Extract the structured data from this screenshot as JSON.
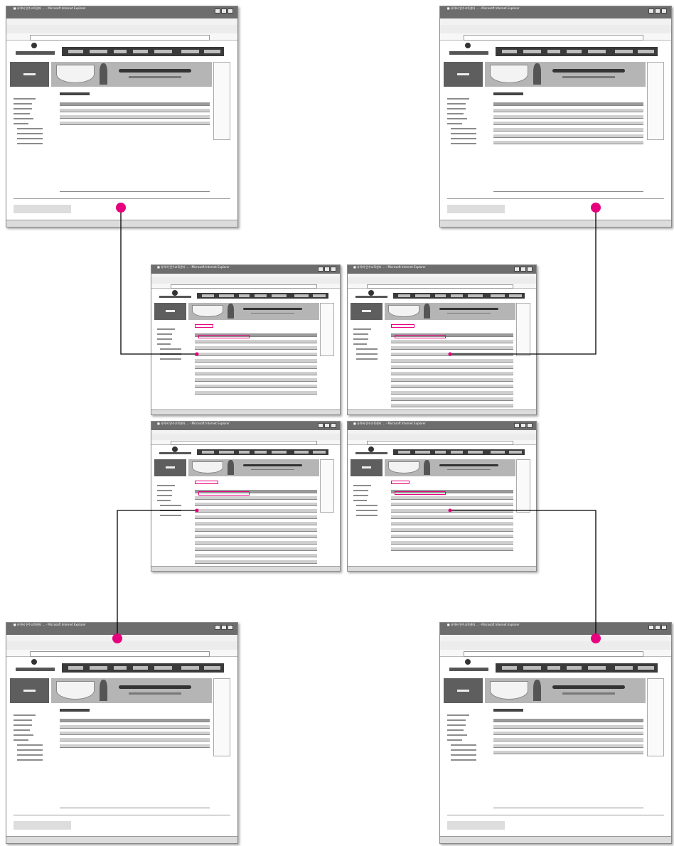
{
  "window_title": "■ 사이버 연수교육센터 ...  - Microsoft Internet Explorer",
  "logo_text": "Cyber 평생교육센터",
  "side_title": "자료실",
  "screens": [
    {
      "id": "top-left",
      "title": "■ 자료실"
    },
    {
      "id": "top-right",
      "title": "■ 자료실"
    },
    {
      "id": "mid-top-left",
      "title": "■ 자료실",
      "label": "유학자료실"
    },
    {
      "id": "mid-top-right",
      "title": "■ 자료실",
      "label": "연수정보자료실"
    },
    {
      "id": "mid-bottom-left",
      "title": "■ 자료실",
      "label": "실무학습자료"
    },
    {
      "id": "mid-bottom-right",
      "title": "■ 자료실",
      "label": "학습자료"
    },
    {
      "id": "bottom-left",
      "title": "■ 자료실"
    },
    {
      "id": "bottom-right",
      "title": "■ 자료실"
    }
  ],
  "colors": {
    "connector": "#000000",
    "highlight": "#e6007e",
    "dot": "#e6007e"
  }
}
